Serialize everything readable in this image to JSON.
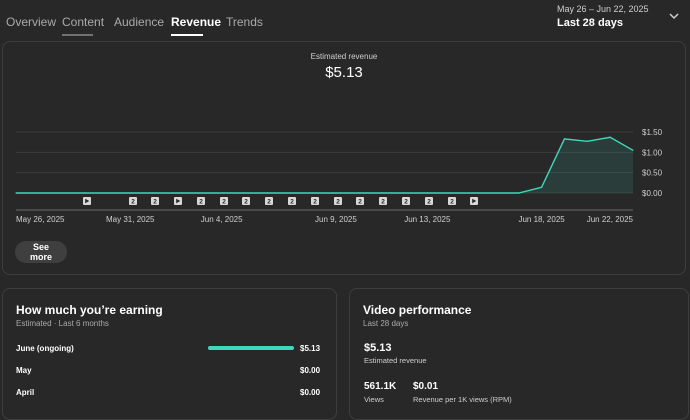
{
  "tabs": [
    {
      "label": "Overview"
    },
    {
      "label": "Content"
    },
    {
      "label": "Audience"
    },
    {
      "label": "Revenue"
    },
    {
      "label": "Trends"
    }
  ],
  "active_tab": "Revenue",
  "date_picker": {
    "range": "May 26 – Jun 22, 2025",
    "label": "Last 28 days"
  },
  "revenue_card": {
    "metric_title": "Estimated revenue",
    "metric_value": "$5.13",
    "see_more_label": "See more",
    "upload_marker_labels": [
      "2",
      "2",
      "2",
      "2",
      "2",
      "2",
      "2",
      "2",
      "2",
      "2",
      "2",
      "2",
      "2",
      "2"
    ]
  },
  "chart_data": {
    "type": "area",
    "title": "",
    "x": [
      "May 26",
      "May 27",
      "May 28",
      "May 29",
      "May 30",
      "May 31",
      "Jun 1",
      "Jun 2",
      "Jun 3",
      "Jun 4",
      "Jun 5",
      "Jun 6",
      "Jun 7",
      "Jun 8",
      "Jun 9",
      "Jun 10",
      "Jun 11",
      "Jun 12",
      "Jun 13",
      "Jun 14",
      "Jun 15",
      "Jun 16",
      "Jun 17",
      "Jun 18",
      "Jun 19",
      "Jun 20",
      "Jun 21",
      "Jun 22"
    ],
    "series": [
      {
        "values": [
          0,
          0,
          0,
          0,
          0,
          0,
          0,
          0,
          0,
          0,
          0,
          0,
          0,
          0,
          0,
          0,
          0,
          0,
          0,
          0,
          0,
          0,
          0,
          0.14,
          1.33,
          1.27,
          1.37,
          1.05
        ]
      }
    ],
    "x_tick_labels": [
      "May 26, 2025",
      "May 31, 2025",
      "Jun 4, 2025",
      "Jun 9, 2025",
      "Jun 13, 2025",
      "Jun 18, 2025",
      "Jun 22, 2025"
    ],
    "y_tick_labels": [
      "$1.50",
      "$1.00",
      "$0.50",
      "$0.00"
    ],
    "ylim": [
      0,
      1.5
    ],
    "grid": true,
    "line_color": "#3ed8bb"
  },
  "earning_card": {
    "title": "How much you’re earning",
    "subtitle": "Estimated · Last 6 months",
    "rows": [
      {
        "label": "June (ongoing)",
        "value": "$5.13",
        "fraction": 1.0
      },
      {
        "label": "May",
        "value": "$0.00",
        "fraction": 0
      },
      {
        "label": "April",
        "value": "$0.00",
        "fraction": 0
      }
    ]
  },
  "video_performance": {
    "title": "Video performance",
    "subtitle": "Last 28 days",
    "revenue_value": "$5.13",
    "revenue_label": "Estimated revenue",
    "views_value": "561.1K",
    "views_label": "Views",
    "rpm_value": "$0.01",
    "rpm_label": "Revenue per 1K views (RPM)"
  },
  "colors": {
    "accent": "#3ed8bb",
    "background": "#282828",
    "card_border": "#3e3e3e"
  }
}
